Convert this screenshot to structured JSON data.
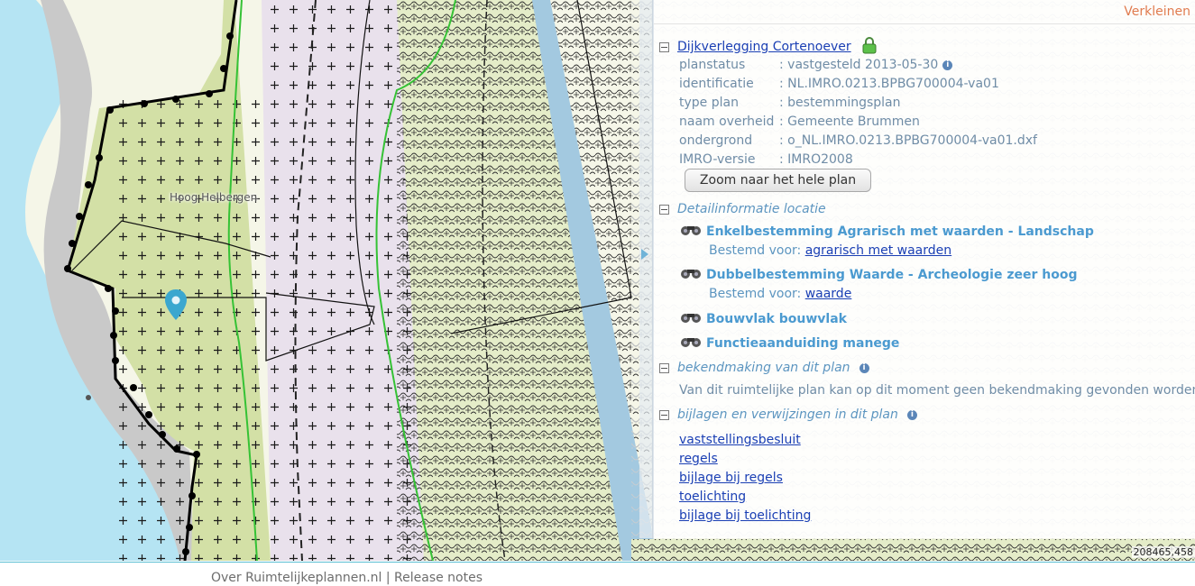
{
  "map": {
    "place_label": "Hoog Helbergen",
    "coordinates": "208465,458"
  },
  "panel": {
    "collapse_label": "Verkleinen",
    "plan": {
      "title": "Dijkverlegging Cortenoever",
      "fields": [
        {
          "key": "planstatus",
          "value": ": vastgesteld 2013-05-30",
          "info": true
        },
        {
          "key": "identificatie",
          "value": ": NL.IMRO.0213.BPBG700004-va01",
          "info": false
        },
        {
          "key": "type plan",
          "value": ": bestemmingsplan",
          "info": false
        },
        {
          "key": "naam overheid",
          "value": ": Gemeente Brummen",
          "info": false
        },
        {
          "key": "ondergrond",
          "value": ": o_NL.IMRO.0213.BPBG700004-va01.dxf",
          "info": false
        },
        {
          "key": "IMRO-versie",
          "value": ": IMRO2008",
          "info": false
        }
      ],
      "zoom_button": "Zoom naar het hele plan"
    },
    "detail": {
      "heading": "Detailinformatie locatie",
      "items": [
        {
          "title": "Enkelbestemming Agrarisch met waarden - Landschap",
          "sub_label": "Bestemd voor:",
          "sub_link": "agrarisch met waarden"
        },
        {
          "title": "Dubbelbestemming Waarde - Archeologie zeer hoog",
          "sub_label": "Bestemd voor:",
          "sub_link": "waarde"
        },
        {
          "title": "Bouwvlak bouwvlak"
        },
        {
          "title": "Functieaanduiding manege"
        }
      ]
    },
    "bekendmaking": {
      "heading": "bekendmaking van dit plan",
      "text": "Van dit ruimtelijke plan kan op dit moment geen bekendmaking gevonden worden"
    },
    "bijlagen": {
      "heading": "bijlagen en verwijzingen in dit plan",
      "links": [
        "vaststellingsbesluit",
        "regels",
        "bijlage bij regels",
        "toelichting",
        "bijlage bij toelichting"
      ]
    }
  },
  "footer": {
    "text": "Over Ruimtelijkeplannen.nl | Release notes"
  }
}
